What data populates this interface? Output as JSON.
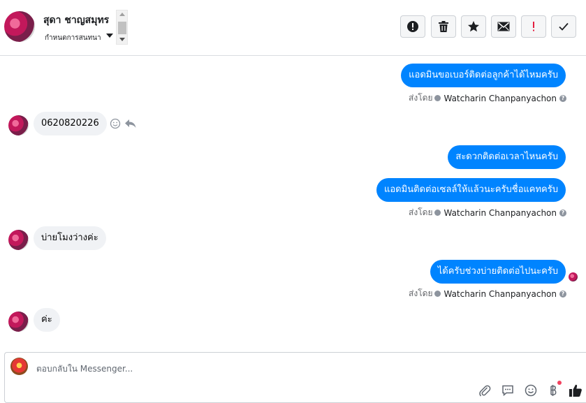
{
  "header": {
    "contact_name": "สุดา ชาญสมุทร",
    "conversation_settings": "กำหนดการสนทนา",
    "actions": [
      {
        "name": "report-spam",
        "icon": "exclamation-circle-icon"
      },
      {
        "name": "delete",
        "icon": "trash-icon"
      },
      {
        "name": "star",
        "icon": "star-icon"
      },
      {
        "name": "mark-unread",
        "icon": "envelope-icon"
      },
      {
        "name": "important",
        "icon": "exclamation-icon"
      },
      {
        "name": "done",
        "icon": "check-icon"
      }
    ]
  },
  "messages": [
    {
      "direction": "out",
      "text": "แอดมินขอเบอร์ติดต่อลูกค้าได้ไหมครับ"
    },
    {
      "type": "sent_by",
      "prefix": "ส่งโดย",
      "name": "Watcharin Chanpanyachon"
    },
    {
      "direction": "in",
      "text": "0620820226"
    },
    {
      "direction": "out",
      "text": "สะดวกติดต่อเวลาไหนครับ"
    },
    {
      "direction": "out",
      "text": "แอดมินติดต่อเซลล์ให้แล้วนะครับชื่อแคทครับ"
    },
    {
      "type": "sent_by",
      "prefix": "ส่งโดย",
      "name": "Watcharin Chanpanyachon"
    },
    {
      "direction": "in",
      "text": "บ่ายโมงว่างค่ะ"
    },
    {
      "direction": "out",
      "text": "ได้ครับช่วงบ่ายติดต่อไปนะครับ"
    },
    {
      "type": "sent_by",
      "prefix": "ส่งโดย",
      "name": "Watcharin Chanpanyachon"
    },
    {
      "direction": "in",
      "text": "ค่ะ"
    }
  ],
  "composer": {
    "placeholder": "ตอบกลับใน Messenger...",
    "icons": [
      "paperclip-icon",
      "saved-reply-icon",
      "emoji-icon",
      "baht-payment-icon",
      "thumbs-up-icon"
    ]
  },
  "colors": {
    "accent": "#0084ff",
    "incoming_bubble": "#f0f2f5",
    "notification_dot": "#f3425f"
  }
}
